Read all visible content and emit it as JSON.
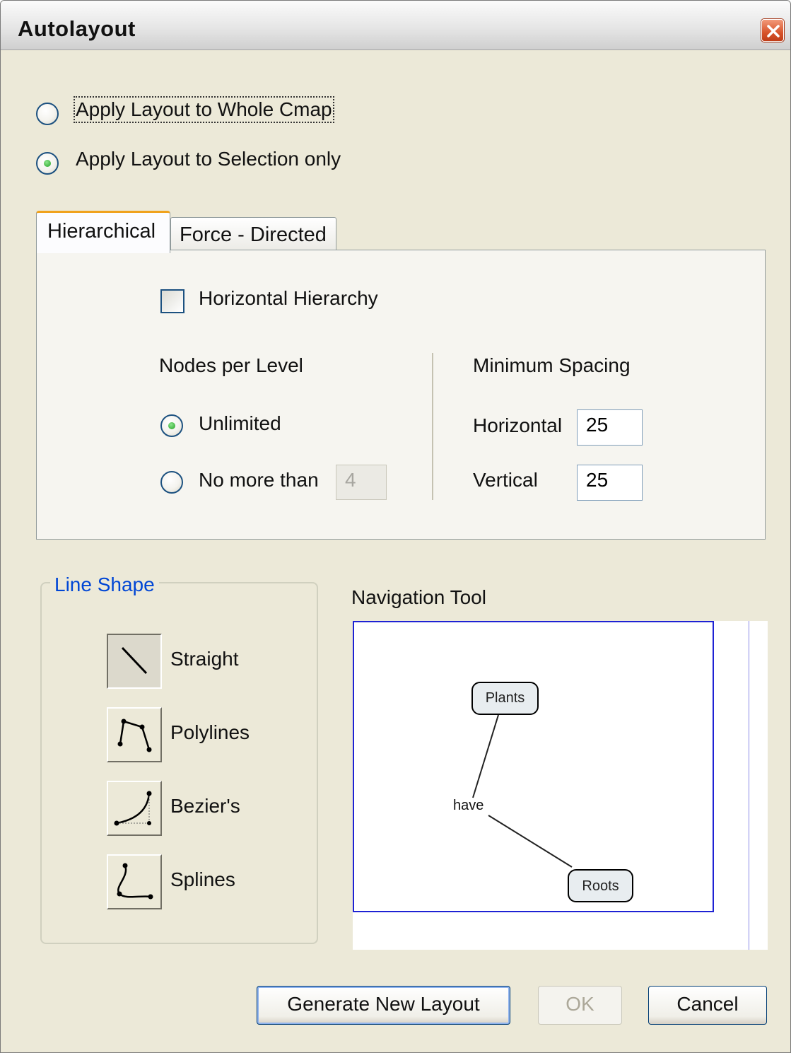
{
  "window": {
    "title": "Autolayout",
    "close_icon": "close-icon",
    "accent_color": "#d8542b"
  },
  "scope": {
    "whole_cmap": {
      "label": "Apply Layout to Whole Cmap",
      "selected": false
    },
    "selection_only": {
      "label": "Apply Layout to Selection only",
      "selected": true
    }
  },
  "tabs": [
    {
      "label": "Hierarchical",
      "active": true
    },
    {
      "label": "Force - Directed",
      "active": false
    }
  ],
  "hierarchical": {
    "horizontal_hierarchy": {
      "label": "Horizontal Hierarchy",
      "checked": false
    },
    "nodes_per_level": {
      "title": "Nodes per Level",
      "unlimited": {
        "label": "Unlimited",
        "selected": true
      },
      "no_more_than": {
        "label": "No more than",
        "selected": false,
        "value": "4"
      }
    },
    "minimum_spacing": {
      "title": "Minimum Spacing",
      "horizontal": {
        "label": "Horizontal",
        "value": "25"
      },
      "vertical": {
        "label": "Vertical",
        "value": "25"
      }
    }
  },
  "line_shape": {
    "title": "Line Shape",
    "options": [
      {
        "label": "Straight",
        "icon": "straight-line-icon",
        "selected": true
      },
      {
        "label": "Polylines",
        "icon": "polyline-icon",
        "selected": false
      },
      {
        "label": "Bezier's",
        "icon": "bezier-icon",
        "selected": false
      },
      {
        "label": "Splines",
        "icon": "spline-icon",
        "selected": false
      }
    ]
  },
  "navigation_tool": {
    "title": "Navigation Tool",
    "nodes": [
      "Plants",
      "Roots"
    ],
    "link_phrase": "have",
    "viewport_color": "#1e22d4"
  },
  "buttons": {
    "generate": "Generate New Layout",
    "ok": "OK",
    "cancel": "Cancel"
  }
}
